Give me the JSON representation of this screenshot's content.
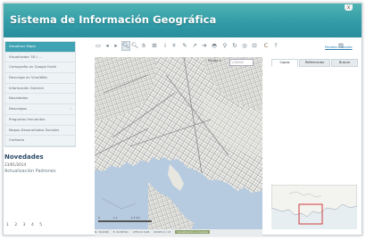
{
  "header": {
    "title": "Sistema de Información Geográfica",
    "close_label": "x"
  },
  "sidebar": {
    "items": [
      {
        "label": "Visualizar Mapa",
        "active": true
      },
      {
        "label": "Visualizador 3D / ..."
      },
      {
        "label": "Cartografía en Google Earth"
      },
      {
        "label": "Descarga en Vivo/Web"
      },
      {
        "label": "Información General"
      },
      {
        "label": "Novedades"
      },
      {
        "label": "Descargas"
      },
      {
        "label": "Preguntas frecuentes"
      },
      {
        "label": "Mapas Desarrollados Sociales"
      },
      {
        "label": "Contacto"
      }
    ]
  },
  "news": {
    "title": "Novedades",
    "date": "23/01/2014",
    "text": "Actualización Padrones",
    "pages": [
      "1",
      "2",
      "3",
      "4",
      "5"
    ]
  },
  "toolbar": {
    "tools": [
      {
        "name": "zoom-extent-icon",
        "glyph": "▭"
      },
      {
        "name": "back-icon",
        "glyph": "◂"
      },
      {
        "name": "forward-icon",
        "glyph": "▸"
      },
      {
        "name": "zoom-in-icon",
        "glyph": "🔍︎",
        "selected": true
      },
      {
        "name": "zoom-out-icon",
        "glyph": "🔍︎"
      },
      {
        "name": "pan-icon",
        "glyph": "✋︎"
      },
      {
        "name": "zoom-box-icon",
        "glyph": "⊞"
      },
      {
        "name": "info-icon",
        "glyph": "i"
      },
      {
        "name": "measure-icon",
        "glyph": "⌗"
      },
      {
        "name": "draw-icon",
        "glyph": "✎"
      },
      {
        "name": "pin-icon",
        "glyph": "↗"
      },
      {
        "name": "select-icon",
        "glyph": "➔"
      },
      {
        "name": "buffer-icon",
        "glyph": "◓"
      },
      {
        "name": "link-icon",
        "glyph": "⚲"
      },
      {
        "name": "rotate-icon",
        "glyph": "↻"
      },
      {
        "name": "target-icon",
        "glyph": "◎"
      },
      {
        "name": "layers-icon",
        "glyph": "⊡"
      },
      {
        "name": "refresh-icon",
        "glyph": "C",
        "round": true
      },
      {
        "name": "help-icon",
        "glyph": "?"
      },
      {
        "name": "print-icon",
        "glyph": "▤"
      }
    ],
    "print_link": "Portales Consulta"
  },
  "map": {
    "scale_label": "Escala 1:",
    "scale_placeholder": "1:50000",
    "scale_ticks": [
      "0",
      "1.1",
      "2.1 km"
    ]
  },
  "statusbar": {
    "items": [
      "N: 302268",
      "E: 6138761",
      "UTM 21 SUR",
      "ZOOM 9 / 23"
    ],
    "highlight": "Visualización completa"
  },
  "panel": {
    "tabs": [
      "Capas",
      "Referencias",
      "Buscar"
    ],
    "active_tab": 0
  },
  "colors": {
    "header": "#2f9aa6",
    "menu_active": "#3fa3b3",
    "water": "#b6cbe0",
    "land": "#f2f1ec",
    "streets": "#8e9196",
    "minimap_box": "#d23b3b"
  }
}
